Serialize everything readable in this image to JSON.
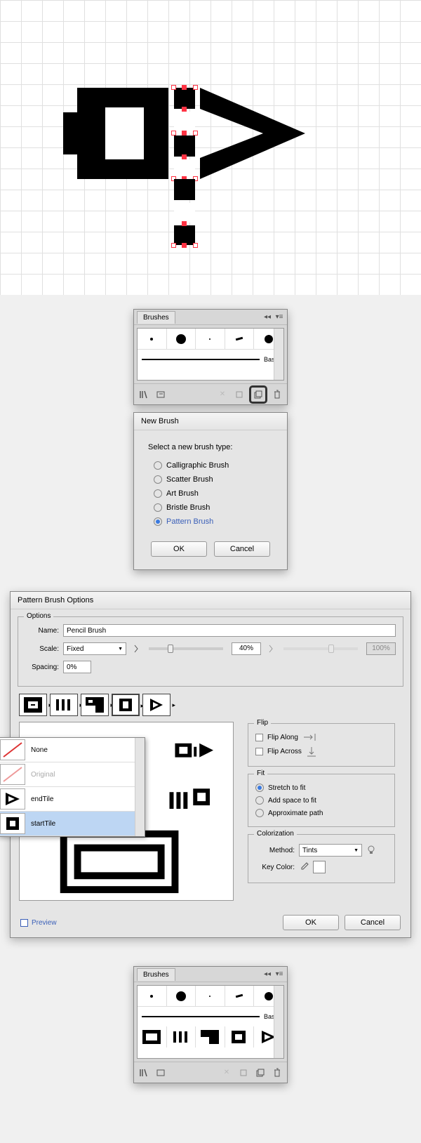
{
  "brushes_panel": {
    "title": "Brushes",
    "basic_label": "Basic"
  },
  "new_brush_dialog": {
    "title": "New Brush",
    "prompt": "Select a new brush type:",
    "options": {
      "calligraphic": "Calligraphic Brush",
      "scatter": "Scatter Brush",
      "art": "Art Brush",
      "bristle": "Bristle Brush",
      "pattern": "Pattern Brush"
    },
    "ok": "OK",
    "cancel": "Cancel"
  },
  "pbo": {
    "title": "Pattern Brush Options",
    "options_legend": "Options",
    "name_label": "Name:",
    "name_value": "Pencil Brush",
    "scale_label": "Scale:",
    "scale_mode": "Fixed",
    "scale_value": "40%",
    "scale_max": "100%",
    "spacing_label": "Spacing:",
    "spacing_value": "0%",
    "flip_legend": "Flip",
    "flip_along": "Flip Along",
    "flip_across": "Flip Across",
    "fit_legend": "Fit",
    "fit_stretch": "Stretch to fit",
    "fit_addspace": "Add space to fit",
    "fit_approx": "Approximate path",
    "color_legend": "Colorization",
    "method_label": "Method:",
    "method_value": "Tints",
    "keycolor_label": "Key Color:",
    "menu_none": "None",
    "menu_original": "Original",
    "menu_end": "endTile",
    "menu_start": "startTile",
    "preview": "Preview",
    "ok": "OK",
    "cancel": "Cancel"
  },
  "chart_data": null
}
